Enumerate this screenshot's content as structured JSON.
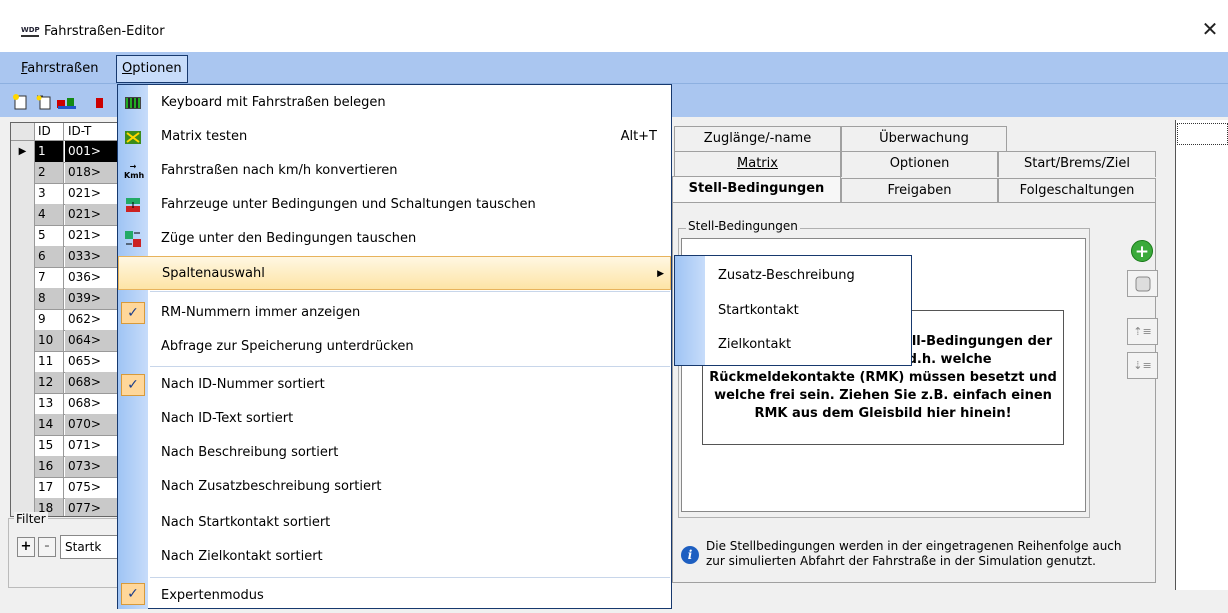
{
  "window": {
    "title": "Fahrstraßen-Editor",
    "logo_text": "WDP",
    "close_glyph": "✕"
  },
  "menubar": {
    "items": [
      {
        "label": "Fahrstraßen",
        "mnemonic": "F",
        "rest": "ahrstraßen"
      },
      {
        "label": "Optionen",
        "mnemonic": "O",
        "rest": "ptionen"
      }
    ]
  },
  "toolbar": {
    "icons": [
      "new-route-icon",
      "copy-route-icon",
      "route-color-icon",
      "route-delete-icon"
    ]
  },
  "grid": {
    "headers": [
      "ID",
      "ID-T"
    ],
    "rows": [
      {
        "id": "1",
        "text": "001>",
        "selected": true
      },
      {
        "id": "2",
        "text": "018>"
      },
      {
        "id": "3",
        "text": "021>"
      },
      {
        "id": "4",
        "text": "021>"
      },
      {
        "id": "5",
        "text": "021>"
      },
      {
        "id": "6",
        "text": "033>"
      },
      {
        "id": "7",
        "text": "036>"
      },
      {
        "id": "8",
        "text": "039>"
      },
      {
        "id": "9",
        "text": "062>"
      },
      {
        "id": "10",
        "text": "064>"
      },
      {
        "id": "11",
        "text": "065>"
      },
      {
        "id": "12",
        "text": "068>"
      },
      {
        "id": "13",
        "text": "068>"
      },
      {
        "id": "14",
        "text": "070>"
      },
      {
        "id": "15",
        "text": "071>"
      },
      {
        "id": "16",
        "text": "073>"
      },
      {
        "id": "17",
        "text": "075>"
      },
      {
        "id": "18",
        "text": "077>"
      }
    ]
  },
  "filter": {
    "label": "Filter",
    "plus": "+",
    "minus": "-",
    "combo_value": "Startk"
  },
  "tabs": {
    "row1": [
      "Zuglänge/-name",
      "Überwachung"
    ],
    "row2": [
      "Matrix",
      "Optionen",
      "Start/Brems/Ziel"
    ],
    "row3": [
      "Stell-Bedingungen",
      "Freigaben",
      "Folgeschaltungen"
    ]
  },
  "stell": {
    "group_label": "Stell-Bedingungen",
    "hint_line1": "ell-Bedingungen der",
    "hint_line2": "en d.h. welche",
    "hint_line3": "Rückmeldekontakte (RMK) müssen besetzt und",
    "hint_line4": "welche frei sein. Ziehen Sie z.B. einfach einen",
    "hint_line5": "RMK aus dem Gleisbild hier hinein!",
    "info_line1": "Die Stellbedingungen werden in der eingetragenen Reihenfolge auch",
    "info_line2": "zur simulierten Abfahrt der Fahrstraße in der Simulation genutzt."
  },
  "options_menu": {
    "items": [
      {
        "label": "Keyboard mit Fahrstraßen belegen",
        "icon": "keyboard-icon"
      },
      {
        "label": "Matrix testen",
        "shortcut": "Alt+T",
        "icon": "matrix-icon"
      },
      {
        "label": "Fahrstraßen nach km/h konvertieren",
        "icon": "kmh-icon",
        "icon_text": "Kmh"
      },
      {
        "label": "Fahrzeuge unter Bedingungen und Schaltungen tauschen",
        "icon": "vehicle-swap-icon"
      },
      {
        "label": "Züge unter den Bedingungen tauschen",
        "icon": "train-swap-icon"
      },
      {
        "label": "Spaltenauswahl",
        "submenu": true
      },
      {
        "label": "RM-Nummern immer anzeigen",
        "checked": true
      },
      {
        "label": "Abfrage zur Speicherung unterdrücken"
      },
      {
        "label": "Nach ID-Nummer sortiert",
        "checked": true
      },
      {
        "label": "Nach ID-Text sortiert"
      },
      {
        "label": "Nach Beschreibung sortiert"
      },
      {
        "label": "Nach Zusatzbeschreibung sortiert"
      },
      {
        "label": "Nach Startkontakt sortiert"
      },
      {
        "label": "Nach Zielkontakt sortiert"
      },
      {
        "label": "Expertenmodus",
        "checked": true
      }
    ],
    "check_glyph": "✓",
    "submenu_arrow": "▶"
  },
  "column_submenu": {
    "items": [
      "Zusatz-Beschreibung",
      "Startkontakt",
      "Zielkontakt"
    ]
  },
  "side_buttons": {
    "add_glyph": "+",
    "remove_glyph": "",
    "up_glyph": "⇡≡",
    "down_glyph": "⇣≡"
  },
  "colors": {
    "menubar_bg": "#aac6f0",
    "menu_border": "#17396e",
    "highlight": "#fde4a6",
    "check_bg": "#ffd79a"
  }
}
